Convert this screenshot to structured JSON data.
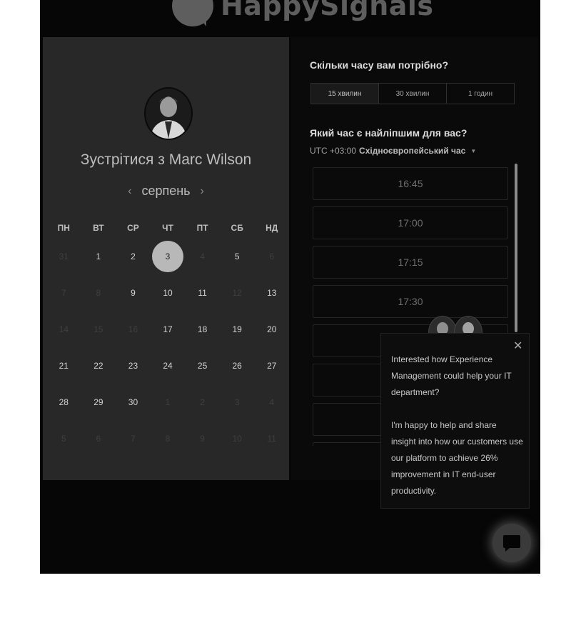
{
  "brand": {
    "name": "HappySignals"
  },
  "left": {
    "meet_title": "Зустрітися з Marc Wilson",
    "month": "серпень",
    "prev_arrow": "‹",
    "next_arrow": "›",
    "weekdays": [
      "ПН",
      "ВТ",
      "СР",
      "ЧТ",
      "ПТ",
      "СБ",
      "НД"
    ],
    "weeks": [
      [
        {
          "d": "31",
          "s": "dim"
        },
        {
          "d": "1",
          "s": "avail"
        },
        {
          "d": "2",
          "s": "avail"
        },
        {
          "d": "3",
          "s": "selected"
        },
        {
          "d": "4",
          "s": "dim"
        },
        {
          "d": "5",
          "s": "avail"
        },
        {
          "d": "6",
          "s": "dim"
        }
      ],
      [
        {
          "d": "7",
          "s": "dim"
        },
        {
          "d": "8",
          "s": "dim"
        },
        {
          "d": "9",
          "s": "avail"
        },
        {
          "d": "10",
          "s": "avail"
        },
        {
          "d": "11",
          "s": "avail"
        },
        {
          "d": "12",
          "s": "dim"
        },
        {
          "d": "13",
          "s": "avail"
        }
      ],
      [
        {
          "d": "14",
          "s": "dim"
        },
        {
          "d": "15",
          "s": "dim"
        },
        {
          "d": "16",
          "s": "dim"
        },
        {
          "d": "17",
          "s": "avail"
        },
        {
          "d": "18",
          "s": "avail"
        },
        {
          "d": "19",
          "s": "avail"
        },
        {
          "d": "20",
          "s": "avail"
        }
      ],
      [
        {
          "d": "21",
          "s": "avail"
        },
        {
          "d": "22",
          "s": "avail"
        },
        {
          "d": "23",
          "s": "avail"
        },
        {
          "d": "24",
          "s": "avail"
        },
        {
          "d": "25",
          "s": "avail"
        },
        {
          "d": "26",
          "s": "avail"
        },
        {
          "d": "27",
          "s": "avail"
        }
      ],
      [
        {
          "d": "28",
          "s": "avail"
        },
        {
          "d": "29",
          "s": "avail"
        },
        {
          "d": "30",
          "s": "avail"
        },
        {
          "d": "1",
          "s": "dim"
        },
        {
          "d": "2",
          "s": "dim"
        },
        {
          "d": "3",
          "s": "dim"
        },
        {
          "d": "4",
          "s": "dim"
        }
      ],
      [
        {
          "d": "5",
          "s": "dim"
        },
        {
          "d": "6",
          "s": "dim"
        },
        {
          "d": "7",
          "s": "dim"
        },
        {
          "d": "8",
          "s": "dim"
        },
        {
          "d": "9",
          "s": "dim"
        },
        {
          "d": "10",
          "s": "dim"
        },
        {
          "d": "11",
          "s": "dim"
        }
      ]
    ]
  },
  "right": {
    "duration_question": "Скільки часу вам потрібно?",
    "durations": [
      "15 хвилин",
      "30 хвилин",
      "1 годин"
    ],
    "time_question": "Який час є найліпшим для вас?",
    "tz_offset": "UTC +03:00",
    "tz_name": "Східноєвропейський час",
    "slots": [
      "16:45",
      "17:00",
      "17:15",
      "17:30",
      "",
      "",
      "",
      ""
    ]
  },
  "chat": {
    "paragraph1": "Interested how Experience Management could help your IT department?",
    "paragraph2": "I'm happy to help and share insight into how our customers use our platform to achieve 26% improvement in IT end-user productivity.",
    "close_icon": "close-icon",
    "button_icon": "chat-bubble-icon"
  }
}
